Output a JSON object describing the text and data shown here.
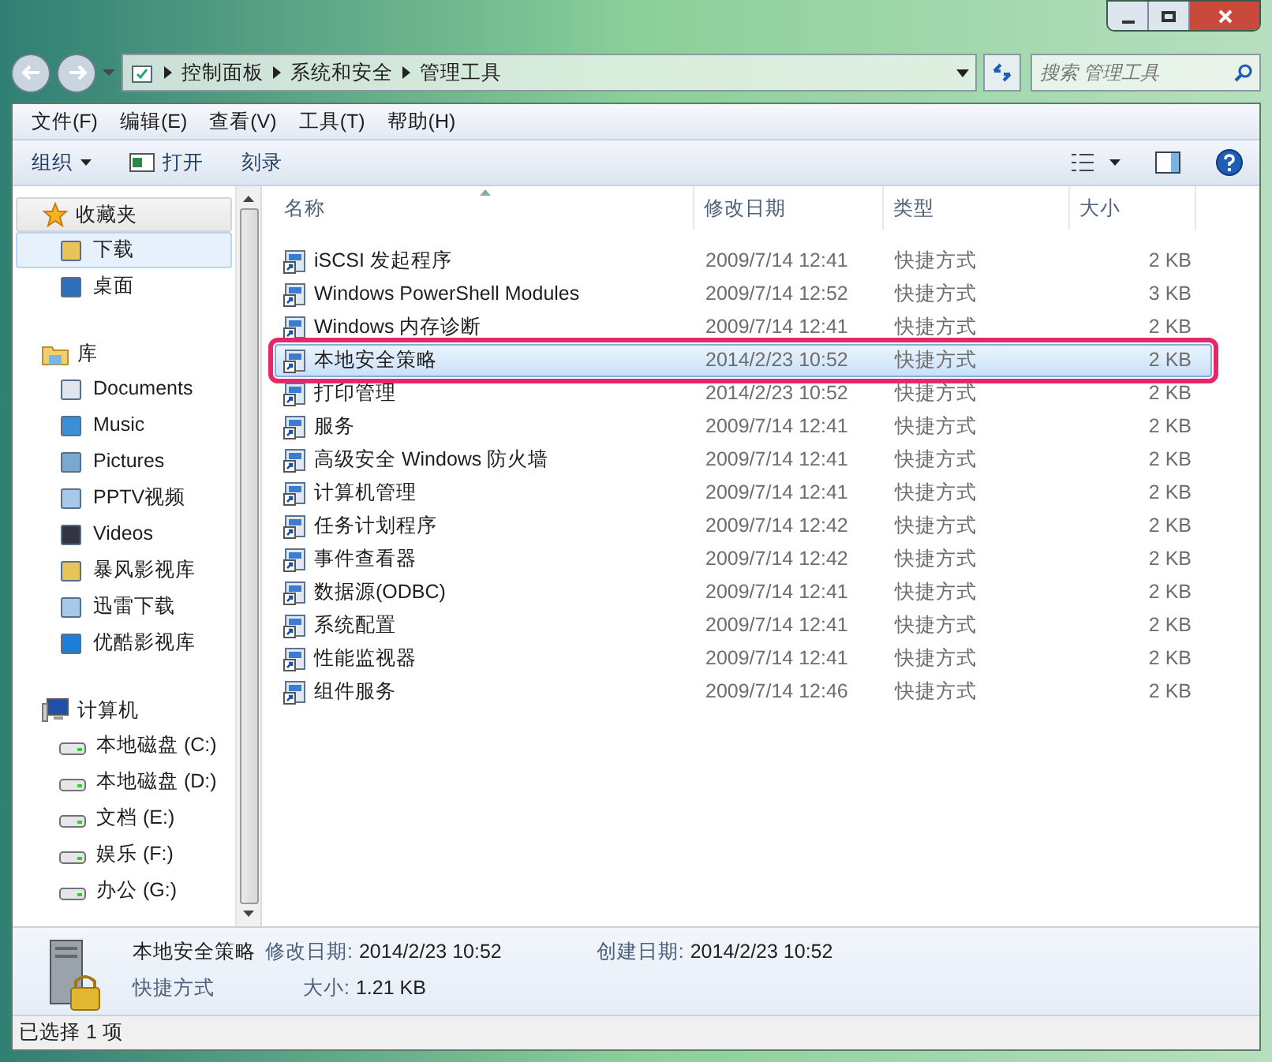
{
  "address_bar": {
    "breadcrumbs": [
      "控制面板",
      "系统和安全",
      "管理工具"
    ]
  },
  "search": {
    "placeholder": "搜索 管理工具"
  },
  "menu": [
    "文件(F)",
    "编辑(E)",
    "查看(V)",
    "工具(T)",
    "帮助(H)"
  ],
  "toolbar": [
    {
      "label": "组织",
      "kind": "dropdown"
    },
    {
      "label": "打开",
      "kind": "icon"
    },
    {
      "label": "刻录",
      "kind": "plain"
    }
  ],
  "sidebar": [
    {
      "label": "收藏夹",
      "children": [
        {
          "label": "下载",
          "selected": true
        },
        {
          "label": "桌面",
          "selected": false
        }
      ]
    },
    {
      "label": "库",
      "children": [
        {
          "label": "Documents",
          "selected": false
        },
        {
          "label": "Music",
          "selected": false
        },
        {
          "label": "Pictures",
          "selected": false
        },
        {
          "label": "PPTV视频",
          "selected": false
        },
        {
          "label": "Videos",
          "selected": false
        },
        {
          "label": "暴风影视库",
          "selected": false
        },
        {
          "label": "迅雷下载",
          "selected": false
        },
        {
          "label": "优酷影视库",
          "selected": false
        }
      ]
    },
    {
      "label": "计算机",
      "children": [
        {
          "label": "本地磁盘 (C:)",
          "selected": false
        },
        {
          "label": "本地磁盘 (D:)",
          "selected": false
        },
        {
          "label": "文档 (E:)",
          "selected": false
        },
        {
          "label": "娱乐 (F:)",
          "selected": false
        },
        {
          "label": "办公 (G:)",
          "selected": false
        }
      ]
    }
  ],
  "columns": [
    "名称",
    "修改日期",
    "类型",
    "大小"
  ],
  "rows": [
    {
      "name": "iSCSI 发起程序",
      "date": "2009/7/14 12:41",
      "type": "快捷方式",
      "size": "2 KB",
      "selected": false
    },
    {
      "name": "Windows PowerShell Modules",
      "date": "2009/7/14 12:52",
      "type": "快捷方式",
      "size": "3 KB",
      "selected": false
    },
    {
      "name": "Windows 内存诊断",
      "date": "2009/7/14 12:41",
      "type": "快捷方式",
      "size": "2 KB",
      "selected": false
    },
    {
      "name": "本地安全策略",
      "date": "2014/2/23 10:52",
      "type": "快捷方式",
      "size": "2 KB",
      "selected": true
    },
    {
      "name": "打印管理",
      "date": "2014/2/23 10:52",
      "type": "快捷方式",
      "size": "2 KB",
      "selected": false
    },
    {
      "name": "服务",
      "date": "2009/7/14 12:41",
      "type": "快捷方式",
      "size": "2 KB",
      "selected": false
    },
    {
      "name": "高级安全 Windows 防火墙",
      "date": "2009/7/14 12:41",
      "type": "快捷方式",
      "size": "2 KB",
      "selected": false
    },
    {
      "name": "计算机管理",
      "date": "2009/7/14 12:41",
      "type": "快捷方式",
      "size": "2 KB",
      "selected": false
    },
    {
      "name": "任务计划程序",
      "date": "2009/7/14 12:42",
      "type": "快捷方式",
      "size": "2 KB",
      "selected": false
    },
    {
      "name": "事件查看器",
      "date": "2009/7/14 12:42",
      "type": "快捷方式",
      "size": "2 KB",
      "selected": false
    },
    {
      "name": "数据源(ODBC)",
      "date": "2009/7/14 12:41",
      "type": "快捷方式",
      "size": "2 KB",
      "selected": false
    },
    {
      "name": "系统配置",
      "date": "2009/7/14 12:41",
      "type": "快捷方式",
      "size": "2 KB",
      "selected": false
    },
    {
      "name": "性能监视器",
      "date": "2009/7/14 12:41",
      "type": "快捷方式",
      "size": "2 KB",
      "selected": false
    },
    {
      "name": "组件服务",
      "date": "2009/7/14 12:46",
      "type": "快捷方式",
      "size": "2 KB",
      "selected": false
    }
  ],
  "details": {
    "name": "本地安全策略",
    "type": "快捷方式",
    "modified_label": "修改日期:",
    "modified": "2014/2/23 10:52",
    "created_label": "创建日期:",
    "created": "2014/2/23 10:52",
    "size_label": "大小:",
    "size": "1.21 KB"
  },
  "status_bar": "已选择 1 项"
}
